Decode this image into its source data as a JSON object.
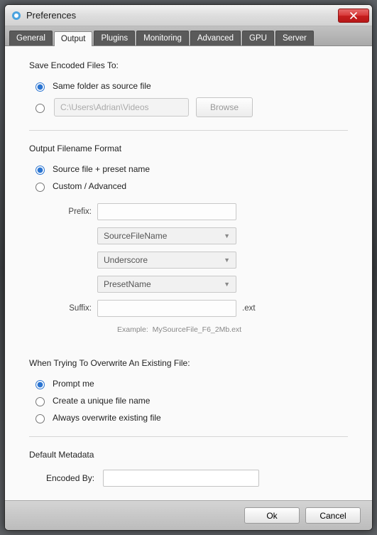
{
  "window": {
    "title": "Preferences"
  },
  "tabs": [
    "General",
    "Output",
    "Plugins",
    "Monitoring",
    "Advanced",
    "GPU",
    "Server"
  ],
  "active_tab": "Output",
  "save_section": {
    "title": "Save Encoded Files To:",
    "option_same": "Same folder as source file",
    "path_value": "C:\\Users\\Adrian\\Videos",
    "browse_label": "Browse"
  },
  "format_section": {
    "title": "Output Filename Format",
    "option_preset": "Source file + preset name",
    "option_custom": "Custom / Advanced",
    "prefix_label": "Prefix:",
    "token1": "SourceFileName",
    "token2": "Underscore",
    "token3": "PresetName",
    "suffix_label": "Suffix:",
    "ext_label": ".ext",
    "example_label": "Example:",
    "example_value": "MySourceFile_F6_2Mb.ext"
  },
  "overwrite_section": {
    "title": "When Trying To Overwrite An Existing File:",
    "opt_prompt": "Prompt me",
    "opt_unique": "Create a unique file name",
    "opt_always": "Always overwrite existing file"
  },
  "metadata_section": {
    "title": "Default Metadata",
    "encoded_by_label": "Encoded By:",
    "encoded_by_value": ""
  },
  "footer": {
    "ok": "Ok",
    "cancel": "Cancel"
  }
}
